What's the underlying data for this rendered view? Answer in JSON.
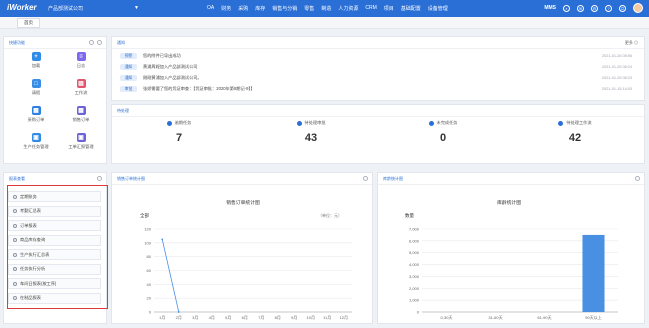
{
  "header": {
    "logo": "iWorker",
    "company": "产品部测试公司",
    "caret": "▼",
    "nav": [
      "OA",
      "财务",
      "采购",
      "库存",
      "销售与分销",
      "零售",
      "制造",
      "人力资源",
      "CRM",
      "项目",
      "基础配置",
      "设备管理"
    ],
    "user_code": "MMS"
  },
  "tabs": [
    "首页"
  ],
  "quick": {
    "title": "快捷功能",
    "items": [
      {
        "label": "加载",
        "color": "#2f8be6",
        "glyph": "+"
      },
      {
        "label": "日志",
        "color": "#7b68ee",
        "glyph": "≡"
      },
      {
        "label": "请假",
        "color": "#3a8ee6",
        "glyph": "□"
      },
      {
        "label": "工作流",
        "color": "#e0566e",
        "glyph": "▤"
      },
      {
        "label": "采购订单",
        "color": "#2d7fe0",
        "glyph": "▦"
      },
      {
        "label": "销售订单",
        "color": "#6c63d9",
        "glyph": "▦"
      },
      {
        "label": "生产任务管理",
        "color": "#2f8be6",
        "glyph": "▣"
      },
      {
        "label": "工单汇报管理",
        "color": "#6c63d9",
        "glyph": "▣"
      }
    ]
  },
  "notice": {
    "title": "通知",
    "more": "更多",
    "rows": [
      {
        "badge": "预警",
        "text": "您的附件已导出成功",
        "time": "2021-01-26 08:56"
      },
      {
        "badge": "通知",
        "text": "黄浦周妮加入产品部测试公司",
        "time": "2021-01-25 08:24"
      },
      {
        "badge": "通知",
        "text": "刚刚黄浦加入产品部测试公司。",
        "time": "2021-01-25 08:23"
      },
      {
        "badge": "审批",
        "text": "张娇需要了您的凭证审查：【凭证审批：2020年第8期记-9】】",
        "time": "2021-01-15 14:03"
      }
    ]
  },
  "todo": {
    "title": "待处理",
    "stats": [
      {
        "label": "逾期任务",
        "value": "7"
      },
      {
        "label": "待处理审批",
        "value": "43"
      },
      {
        "label": "未完成任务",
        "value": "0"
      },
      {
        "label": "待处理工作流",
        "value": "42"
      }
    ]
  },
  "reports": {
    "title": "报表查看",
    "items": [
      "定期账务",
      "考勤汇总表",
      "订单报表",
      "商品库存查询",
      "生产执行汇总表",
      "任务执行分析",
      "车间日报表(按工序)",
      "在制品报表"
    ]
  },
  "sales_panel": {
    "title": "销售订单统计图",
    "chart_title": "销售订单统计图",
    "unit": "（单位：元）",
    "filter": "全部"
  },
  "stock_panel": {
    "title": "库龄统计图",
    "chart_title": "库龄统计图",
    "filter": "数量"
  },
  "chart_data": [
    {
      "type": "line",
      "title": "销售订单统计图",
      "categories": [
        "1月",
        "2月",
        "3月",
        "4月",
        "5月",
        "6月",
        "7月",
        "8月",
        "9月",
        "10月",
        "11月",
        "12月"
      ],
      "values": [
        105,
        0,
        null,
        null,
        null,
        null,
        null,
        null,
        null,
        null,
        null,
        null
      ],
      "ylim": [
        0,
        120
      ],
      "yticks": [
        0,
        20,
        40,
        60,
        80,
        100,
        120
      ],
      "color": "#4a90e2",
      "grid": true
    },
    {
      "type": "bar",
      "title": "库龄统计图",
      "categories": [
        "0-30天",
        "31-60天",
        "61-90天",
        "90天以上"
      ],
      "values": [
        0,
        0,
        0,
        6500
      ],
      "ylim": [
        0,
        7000
      ],
      "yticks": [
        0,
        1000,
        2000,
        3000,
        4000,
        5000,
        6000,
        7000
      ],
      "color": "#4a90e2",
      "grid": true
    }
  ]
}
